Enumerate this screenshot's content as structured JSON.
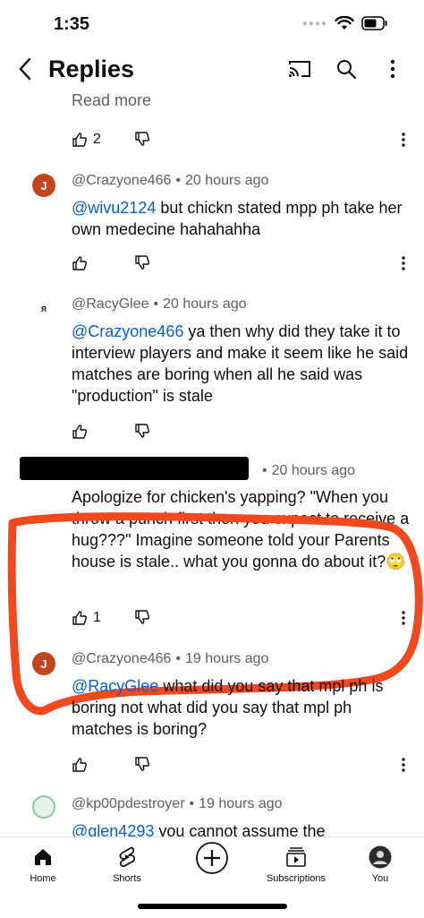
{
  "status_bar": {
    "time": "1:35",
    "battery_icon": "battery-icon",
    "wifi_icon": "wifi-icon"
  },
  "header": {
    "title": "Replies",
    "back_icon": "chevron-left-icon",
    "actions": [
      "cast-icon",
      "search-icon",
      "more-vert-icon"
    ]
  },
  "prev_comment": {
    "read_more": "Read more",
    "like_count": "2"
  },
  "comments": [
    {
      "author": "@Crazyone466",
      "time": "20 hours ago",
      "mention": "@wivu2124",
      "text_line1": " but chickn stated mpp ph",
      "text_rest": "take her own medecine hahahahha",
      "like_count": ""
    },
    {
      "author": "@RacyGlee",
      "time": "20 hours ago",
      "mention": "@Crazyone466",
      "text_line1": " ya then why did they",
      "text_rest": "take it to interview players and make it seem like he said matches are boring when all he said was \"production\" is stale",
      "like_count": ""
    },
    {
      "author": "",
      "time": "20 hours ago",
      "text": "Apologize for chicken's yapping? \"When you throw a punch first then you expect to receive a hug???\" Imagine someone told your Parents house is stale.. what you gonna do about it?🙄",
      "like_count": "1"
    },
    {
      "author": "@Crazyone466",
      "time": "19 hours ago",
      "mention": "@RacyGlee",
      "text_line1": " what did you say that mpl ph",
      "text_rest": "is boring not what did you say that mpl ph matches is boring?",
      "like_count": ""
    },
    {
      "author": "@kp00pdestroyer",
      "time": "19 hours ago",
      "mention": "@glen4293",
      "text_line1": " you cannot assume the"
    }
  ],
  "avatars": {
    "crazyone_initial": "J",
    "racyglee_mark": "ᴙ"
  },
  "bottom_nav": {
    "home": "Home",
    "shorts": "Shorts",
    "subscriptions": "Subscriptions",
    "you": "You"
  },
  "colors": {
    "annotation": "#f2481e",
    "mention": "#065fd4",
    "avatar_j": "#c3451f"
  }
}
